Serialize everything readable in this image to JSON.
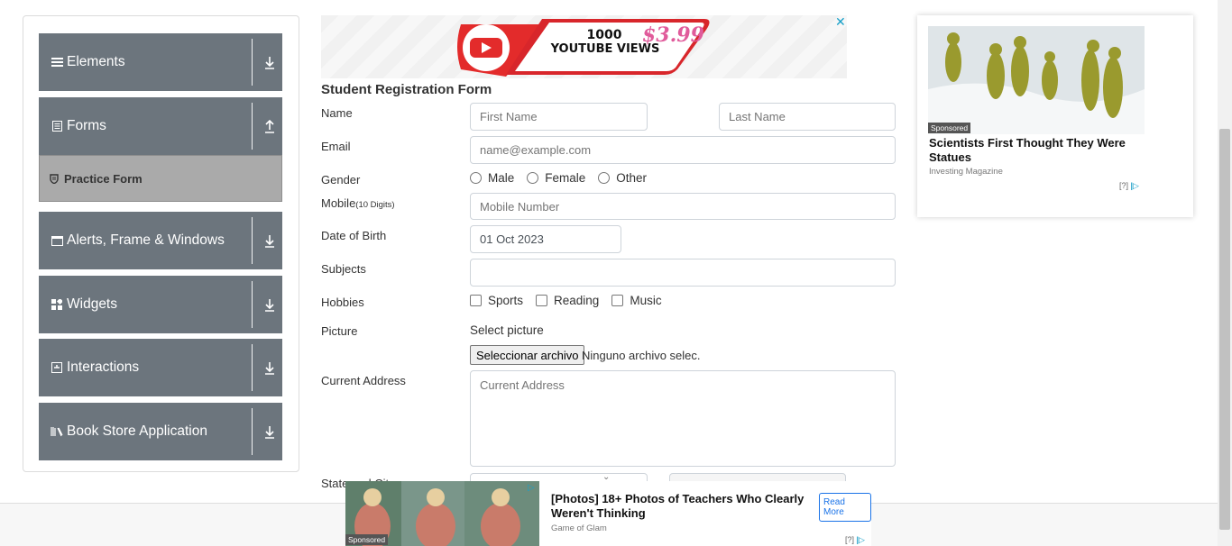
{
  "sidebar": {
    "groups": [
      {
        "label": "Elements",
        "icon": "hamburger-icon",
        "arrow": "down"
      },
      {
        "label": "Forms",
        "icon": "form-icon",
        "arrow": "up"
      },
      {
        "label": "Alerts, Frame & Windows",
        "icon": "window-icon",
        "arrow": "down"
      },
      {
        "label": "Widgets",
        "icon": "widgets-icon",
        "arrow": "down"
      },
      {
        "label": "Interactions",
        "icon": "interactions-icon",
        "arrow": "down"
      },
      {
        "label": "Book Store Application",
        "icon": "books-icon",
        "arrow": "down"
      }
    ],
    "active_item": {
      "label": "Practice Form",
      "icon": "shield-icon"
    }
  },
  "top_ad": {
    "line1": "1000",
    "line2": "YOUTUBE VIEWS",
    "price": "$3.99",
    "close": "✕"
  },
  "form": {
    "title": "Student Registration Form",
    "name_label": "Name",
    "first_name_placeholder": "First Name",
    "last_name_placeholder": "Last Name",
    "email_label": "Email",
    "email_placeholder": "name@example.com",
    "gender_label": "Gender",
    "gender_options": [
      "Male",
      "Female",
      "Other"
    ],
    "mobile_label": "Mobile",
    "mobile_hint": "(10 Digits)",
    "mobile_placeholder": "Mobile Number",
    "dob_label": "Date of Birth",
    "dob_value": "01 Oct 2023",
    "subjects_label": "Subjects",
    "hobbies_label": "Hobbies",
    "hobbies_options": [
      "Sports",
      "Reading",
      "Music"
    ],
    "picture_label": "Picture",
    "select_picture": "Select picture",
    "file_button": "Seleccionar archivo",
    "file_status": "Ninguno archivo selec.",
    "address_label": "Current Address",
    "address_placeholder": "Current Address",
    "state_city_label": "State and City"
  },
  "right_ad": {
    "sponsored": "Sponsored",
    "headline": "Scientists First Thought They Were Statues",
    "source": "Investing Magazine",
    "adchoice": "[?]"
  },
  "bottom_ad": {
    "sponsored": "Sponsored",
    "headline": "[Photos] 18+ Photos of Teachers Who Clearly Weren't Thinking",
    "source": "Game of Glam",
    "read_more": "Read More",
    "adchoice": "[?]"
  },
  "colors": {
    "sidebar_group": "#6c757d",
    "active_item": "#aaaaaa",
    "accent": "#1a73e8"
  }
}
